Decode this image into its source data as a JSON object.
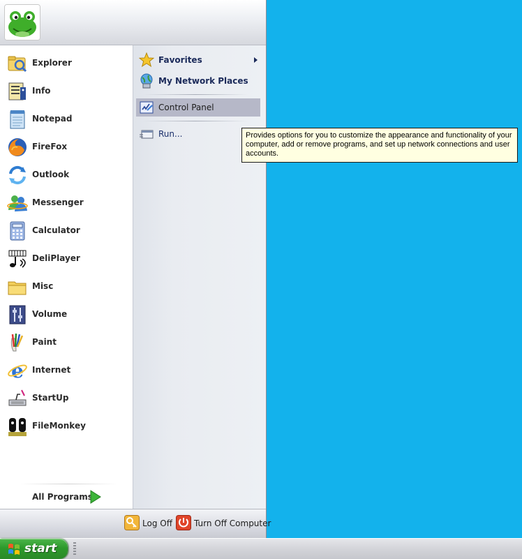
{
  "start_menu": {
    "programs": [
      {
        "label": "Explorer",
        "icon": "explorer-icon"
      },
      {
        "label": "Info",
        "icon": "info-icon"
      },
      {
        "label": "Notepad",
        "icon": "notepad-icon"
      },
      {
        "label": "FireFox",
        "icon": "firefox-icon"
      },
      {
        "label": "Outlook",
        "icon": "outlook-icon"
      },
      {
        "label": "Messenger",
        "icon": "messenger-icon"
      },
      {
        "label": "Calculator",
        "icon": "calculator-icon"
      },
      {
        "label": "DeliPlayer",
        "icon": "deliplayer-icon"
      },
      {
        "label": "Misc",
        "icon": "folder-icon"
      },
      {
        "label": "Volume",
        "icon": "volume-icon"
      },
      {
        "label": "Paint",
        "icon": "paint-icon"
      },
      {
        "label": "Internet",
        "icon": "internet-explorer-icon"
      },
      {
        "label": "StartUp",
        "icon": "startup-icon"
      },
      {
        "label": "FileMonkey",
        "icon": "filemonkey-icon"
      }
    ],
    "all_programs_label": "All Programs",
    "places": [
      {
        "label": "Favorites",
        "icon": "star-icon",
        "submenu": true
      },
      {
        "label": "My Network Places",
        "icon": "network-places-icon"
      },
      {
        "label": "Control Panel",
        "icon": "control-panel-icon",
        "highlighted": true
      },
      {
        "label": "Run...",
        "icon": "run-icon"
      }
    ],
    "footer": {
      "log_off_label": "Log Off",
      "turn_off_label": "Turn Off Computer"
    }
  },
  "tooltip": {
    "text": "Provides options for you to customize the appearance and functionality of your computer, add or remove programs, and set up network connections and user accounts."
  },
  "taskbar": {
    "start_label": "start"
  },
  "colors": {
    "desktop": "#13b2ec",
    "start_green": "#2d9a2b",
    "highlight": "#b6b8c8",
    "tooltip_bg": "#ffffe1"
  }
}
